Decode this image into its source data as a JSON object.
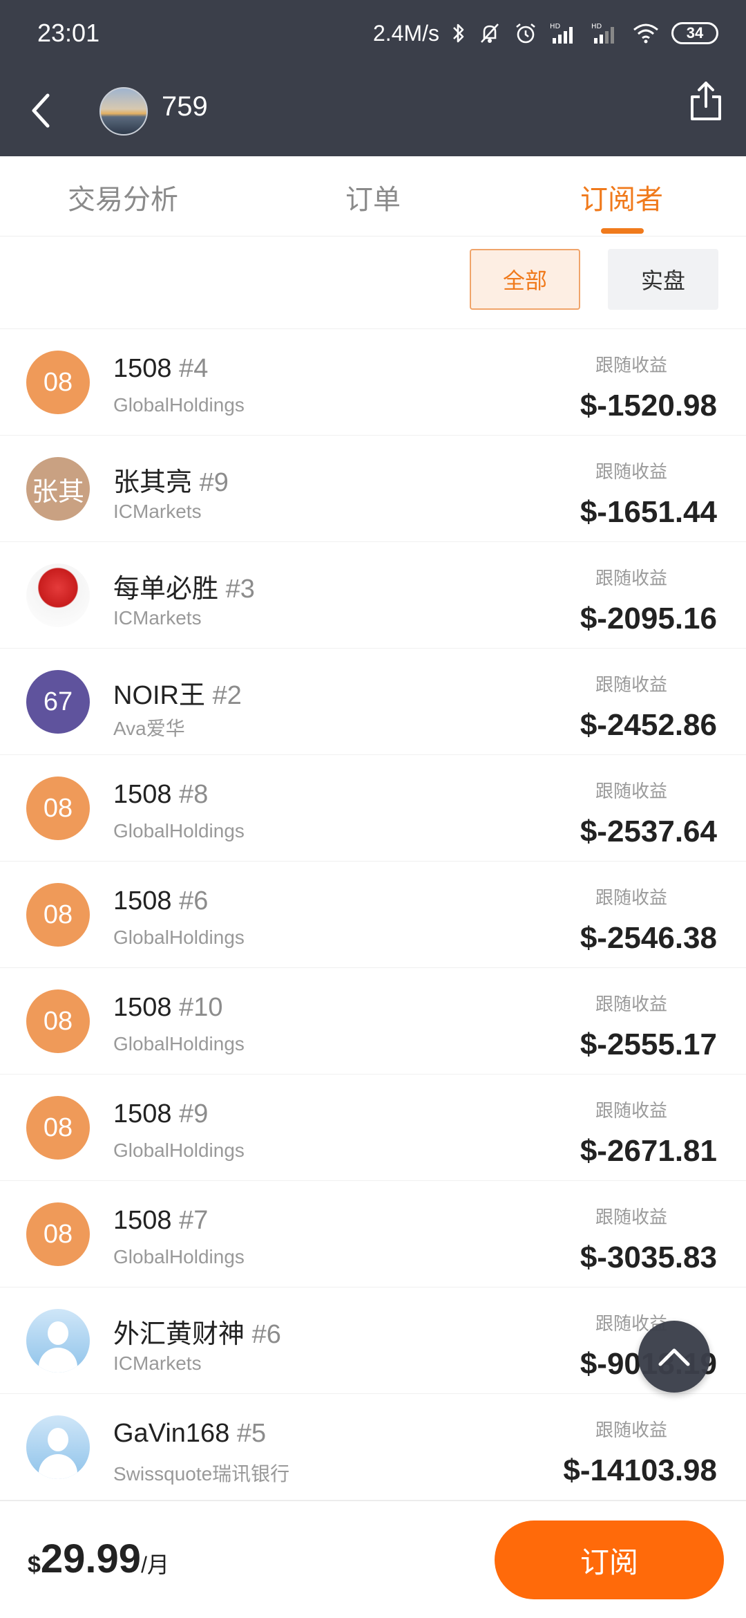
{
  "status_bar": {
    "time": "23:01",
    "net_speed": "2.4M/s",
    "battery": "34",
    "signal1_label": "HD",
    "signal2_label": "HD"
  },
  "header": {
    "user_name": "759",
    "back_icon": "chevron-left-icon",
    "share_icon": "share-icon"
  },
  "tabs": [
    {
      "label": "交易分析",
      "active": false
    },
    {
      "label": "订单",
      "active": false
    },
    {
      "label": "订阅者",
      "active": true
    }
  ],
  "filters": {
    "all": "全部",
    "real": "实盘"
  },
  "subscribers": [
    {
      "avatar_text": "08",
      "avatar_color": "#ef9a59",
      "avatar_kind": "text",
      "name": "1508",
      "rank": "#4",
      "broker": "GlobalHoldings",
      "profit_label": "跟随收益",
      "profit": "$-1520.98"
    },
    {
      "avatar_text": "张其",
      "avatar_color": "#c9a182",
      "avatar_kind": "text",
      "name": "张其亮",
      "rank": "#9",
      "broker": "ICMarkets",
      "profit_label": "跟随收益",
      "profit": "$-1651.44"
    },
    {
      "avatar_text": "",
      "avatar_color": "#e03a3a",
      "avatar_kind": "photo",
      "name": "每单必胜",
      "rank": "#3",
      "broker": "ICMarkets",
      "profit_label": "跟随收益",
      "profit": "$-2095.16"
    },
    {
      "avatar_text": "67",
      "avatar_color": "#5f539d",
      "avatar_kind": "text",
      "name": "NOIR王",
      "rank": "#2",
      "broker": "Ava爱华",
      "profit_label": "跟随收益",
      "profit": "$-2452.86"
    },
    {
      "avatar_text": "08",
      "avatar_color": "#ef9a59",
      "avatar_kind": "text",
      "name": "1508",
      "rank": "#8",
      "broker": "GlobalHoldings",
      "profit_label": "跟随收益",
      "profit": "$-2537.64"
    },
    {
      "avatar_text": "08",
      "avatar_color": "#ef9a59",
      "avatar_kind": "text",
      "name": "1508",
      "rank": "#6",
      "broker": "GlobalHoldings",
      "profit_label": "跟随收益",
      "profit": "$-2546.38"
    },
    {
      "avatar_text": "08",
      "avatar_color": "#ef9a59",
      "avatar_kind": "text",
      "name": "1508",
      "rank": "#10",
      "broker": "GlobalHoldings",
      "profit_label": "跟随收益",
      "profit": "$-2555.17"
    },
    {
      "avatar_text": "08",
      "avatar_color": "#ef9a59",
      "avatar_kind": "text",
      "name": "1508",
      "rank": "#9",
      "broker": "GlobalHoldings",
      "profit_label": "跟随收益",
      "profit": "$-2671.81"
    },
    {
      "avatar_text": "08",
      "avatar_color": "#ef9a59",
      "avatar_kind": "text",
      "name": "1508",
      "rank": "#7",
      "broker": "GlobalHoldings",
      "profit_label": "跟随收益",
      "profit": "$-3035.83"
    },
    {
      "avatar_text": "",
      "avatar_color": "#a9d2f0",
      "avatar_kind": "default",
      "name": "外汇黄财神",
      "rank": "#6",
      "broker": "ICMarkets",
      "profit_label": "跟随收益",
      "profit": "$-9018.19"
    },
    {
      "avatar_text": "",
      "avatar_color": "#a9d2f0",
      "avatar_kind": "default",
      "name": "GaVin168",
      "rank": "#5",
      "broker": "Swissquote瑞讯银行",
      "profit_label": "跟随收益",
      "profit": "$-14103.98"
    }
  ],
  "scroll_top_icon": "chevron-up-icon",
  "bottom_bar": {
    "currency": "$",
    "price": "29.99",
    "unit": "/月",
    "subscribe_label": "订阅"
  },
  "colors": {
    "header_bg": "#3b3f4a",
    "accent": "#f07a1c",
    "subscribe_bg": "#ff6a0a"
  }
}
